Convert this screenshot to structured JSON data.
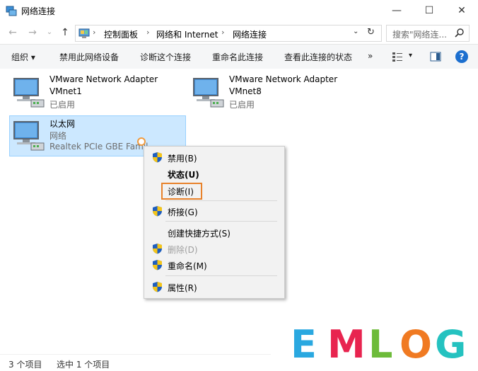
{
  "window": {
    "title": "网络连接",
    "controls": {
      "minimize": "—",
      "maximize": "☐",
      "close": "✕"
    }
  },
  "address": {
    "back": "←",
    "forward": "→",
    "recent": "⌄",
    "up": "↑",
    "crumbs": [
      "控制面板",
      "网络和 Internet",
      "网络连接"
    ],
    "separator": "›",
    "dropdown": "⌄",
    "refresh": "↻",
    "search_placeholder": "搜索\"网络连...",
    "search_icon": "search-icon"
  },
  "toolbar": {
    "organize": "组织 ▾",
    "disable": "禁用此网络设备",
    "diagnose": "诊断这个连接",
    "rename": "重命名此连接",
    "status": "查看此连接的状态",
    "more": "»",
    "view_drop": "▾",
    "help": "?"
  },
  "items": [
    {
      "name": "VMware Network Adapter",
      "line2": "VMnet1",
      "line3": "已启用"
    },
    {
      "name": "VMware Network Adapter",
      "line2": "VMnet8",
      "line3": "已启用"
    },
    {
      "name": "以太网",
      "line2": "网络",
      "line3": "Realtek PCIe GBE Famil"
    }
  ],
  "context_menu": {
    "disable": "禁用(B)",
    "status": "状态(U)",
    "diagnose": "诊断(I)",
    "bridge": "桥接(G)",
    "shortcut": "创建快捷方式(S)",
    "delete": "删除(D)",
    "rename": "重命名(M)",
    "properties": "属性(R)"
  },
  "statusbar": {
    "count": "3 个项目",
    "selected": "选中 1 个项目"
  },
  "watermark": {
    "letters": [
      "E",
      "M",
      "L",
      "O",
      "G"
    ],
    "colors": [
      "#2aa8e0",
      "#e8244f",
      "#6dbb3a",
      "#f07a22",
      "#25c2c0"
    ]
  },
  "colors": {
    "selection_bg": "#cce8ff",
    "highlight": "#e8822b",
    "help": "#1c6fcf"
  }
}
